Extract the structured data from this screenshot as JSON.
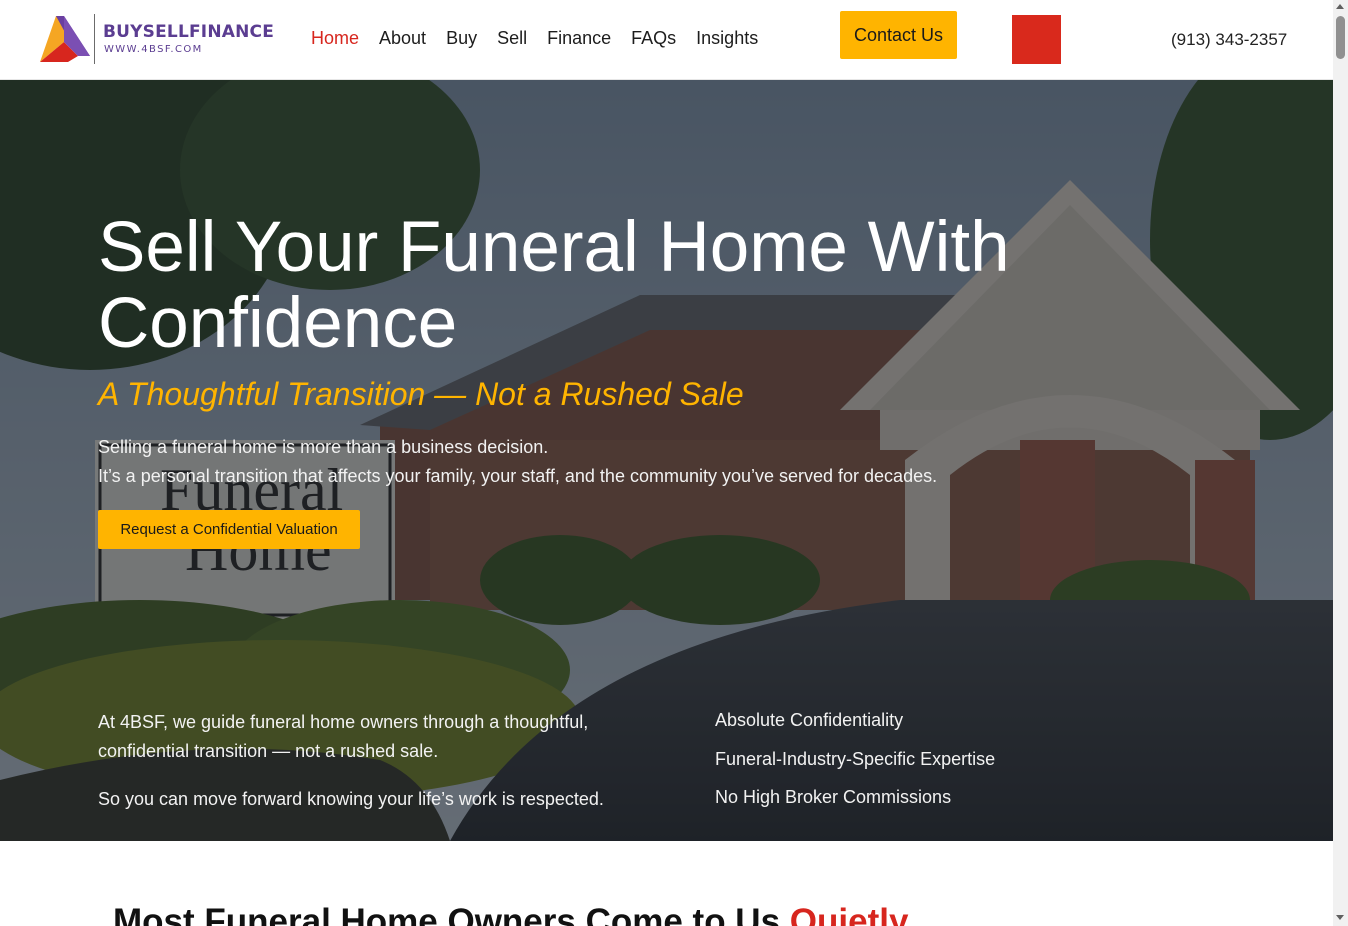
{
  "header": {
    "logo": {
      "name": "BUYSELLFINANCE",
      "url": "WWW.4BSF.COM",
      "icon": "triangle-logo-icon"
    },
    "nav": [
      {
        "label": "Home",
        "active": true
      },
      {
        "label": "About",
        "active": false
      },
      {
        "label": "Buy",
        "active": false
      },
      {
        "label": "Sell",
        "active": false
      },
      {
        "label": "Finance",
        "active": false
      },
      {
        "label": "FAQs",
        "active": false
      },
      {
        "label": "Insights",
        "active": false
      }
    ],
    "contact_label": "Contact Us",
    "phone": "(913) 343-2357"
  },
  "hero": {
    "title_line1": "Sell Your Funeral Home With",
    "title_line2": "Confidence",
    "subtitle": "A Thoughtful Transition — Not a Rushed Sale",
    "para1": "Selling a funeral home is more than a business decision.",
    "para2": "It’s a personal transition that affects your family, your staff, and the community you’ve served for decades.",
    "cta_label": "Request a Confidential Valuation",
    "left_text1": "At 4BSF, we guide funeral home owners through a thoughtful, confidential transition — not a rushed sale.",
    "left_text2": "So you can move forward knowing your life’s work is respected.",
    "features": [
      "Absolute Confidentiality",
      "Funeral-Industry-Specific Expertise",
      "No High Broker Commissions"
    ],
    "background_sign": [
      "Funeral",
      "Home"
    ]
  },
  "section2": {
    "title_main": "Most Funeral Home Owners Come to Us ",
    "title_accent": "Quietly"
  },
  "colors": {
    "accent_yellow": "#ffb400",
    "accent_red": "#d7261e",
    "brand_purple": "#5b3d91",
    "overlay": "#14181e"
  }
}
